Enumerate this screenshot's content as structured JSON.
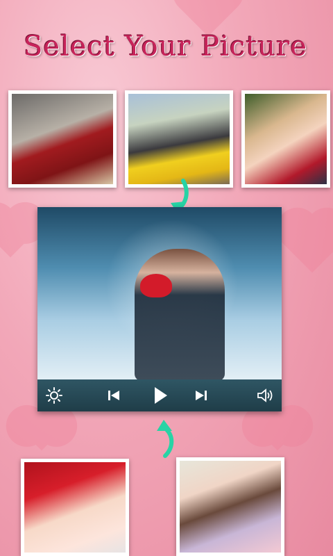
{
  "title": "Select Your Picture",
  "colors": {
    "accent": "#c7245a",
    "arrow": "#27d3a5",
    "control_bar": "#2a4c58"
  },
  "thumbnails_top": [
    {
      "name": "girl-red-coat-photo"
    },
    {
      "name": "couple-bench-photo"
    },
    {
      "name": "kids-kiss-photo"
    }
  ],
  "thumbnails_bottom": [
    {
      "name": "baby-valentine-photo"
    },
    {
      "name": "couple-happy-photo"
    }
  ],
  "player": {
    "controls": [
      "brightness-icon",
      "previous-icon",
      "play-icon",
      "next-icon",
      "volume-icon"
    ]
  }
}
